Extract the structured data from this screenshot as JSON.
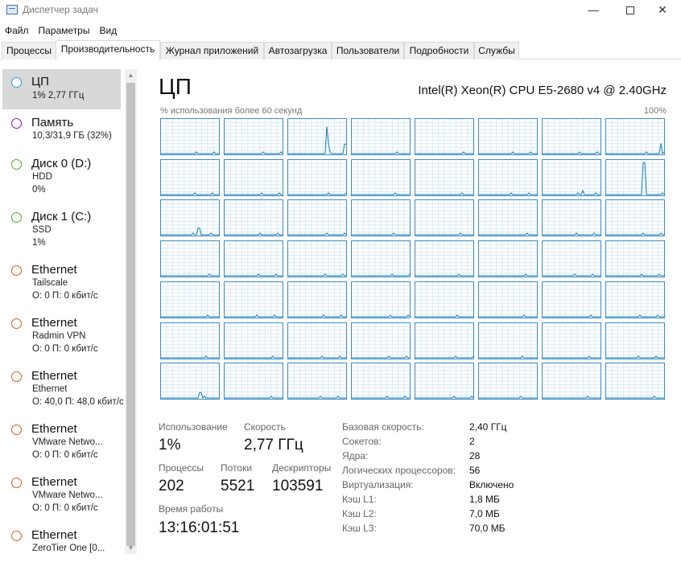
{
  "window": {
    "title": "Диспетчер задач"
  },
  "menu": [
    "Файл",
    "Параметры",
    "Вид"
  ],
  "tabs": [
    "Процессы",
    "Производительность",
    "Журнал приложений",
    "Автозагрузка",
    "Пользователи",
    "Подробности",
    "Службы"
  ],
  "active_tab": "Производительность",
  "sidebar": {
    "items": [
      {
        "title": "ЦП",
        "line1": "1% 2,77 ГГц",
        "line2": "",
        "color": "#1ba1e2",
        "selected": true
      },
      {
        "title": "Память",
        "line1": "10,3/31,9 ГБ (32%)",
        "line2": "",
        "color": "#8b12ae",
        "selected": false
      },
      {
        "title": "Диск 0 (D:)",
        "line1": "HDD",
        "line2": "0%",
        "color": "#4daf1e",
        "selected": false
      },
      {
        "title": "Диск 1 (C:)",
        "line1": "SSD",
        "line2": "1%",
        "color": "#4daf1e",
        "selected": false
      },
      {
        "title": "Ethernet",
        "line1": "Tailscale",
        "line2": "О: 0 П: 0 кбит/с",
        "color": "#c8631b",
        "selected": false
      },
      {
        "title": "Ethernet",
        "line1": "Radmin VPN",
        "line2": "О: 0 П: 0 кбит/с",
        "color": "#c8631b",
        "selected": false
      },
      {
        "title": "Ethernet",
        "line1": "Ethernet",
        "line2": "О: 40,0 П: 48,0 кбит/с",
        "color": "#c8631b",
        "selected": false
      },
      {
        "title": "Ethernet",
        "line1": "VMware Netwo...",
        "line2": "О: 0 П: 0 кбит/с",
        "color": "#c8631b",
        "selected": false
      },
      {
        "title": "Ethernet",
        "line1": "VMware Netwo...",
        "line2": "О: 0 П: 0 кбит/с",
        "color": "#c8631b",
        "selected": false
      },
      {
        "title": "Ethernet",
        "line1": "ZeroTier One [0...",
        "line2": "",
        "color": "#c8631b",
        "selected": false
      }
    ]
  },
  "main": {
    "title": "ЦП",
    "cpu_name": "Intel(R) Xeon(R) CPU E5-2680 v4 @ 2.40GHz",
    "graph_caption": "% использования более 60 секунд",
    "graph_max": "100%",
    "core_graphs": {
      "rows": 7,
      "cols": 8,
      "line_color": "#117dbb",
      "grid_color": "#d9eaf7"
    }
  },
  "stats": {
    "usage_label": "Использование",
    "usage_value": "1%",
    "speed_label": "Скорость",
    "speed_value": "2,77 ГГц",
    "processes_label": "Процессы",
    "processes_value": "202",
    "threads_label": "Потоки",
    "threads_value": "5521",
    "handles_label": "Дескрипторы",
    "handles_value": "103591",
    "uptime_label": "Время работы",
    "uptime_value": "13:16:01:51"
  },
  "details": [
    {
      "label": "Базовая скорость:",
      "value": "2,40 ГГц"
    },
    {
      "label": "Сокетов:",
      "value": "2"
    },
    {
      "label": "Ядра:",
      "value": "28"
    },
    {
      "label": "Логических процессоров:",
      "value": "56"
    },
    {
      "label": "Виртуализация:",
      "value": "Включено"
    },
    {
      "label": "Кэш L1:",
      "value": "1,8 МБ"
    },
    {
      "label": "Кэш L2:",
      "value": "7,0 МБ"
    },
    {
      "label": "Кэш L3:",
      "value": "70,0 МБ"
    }
  ]
}
